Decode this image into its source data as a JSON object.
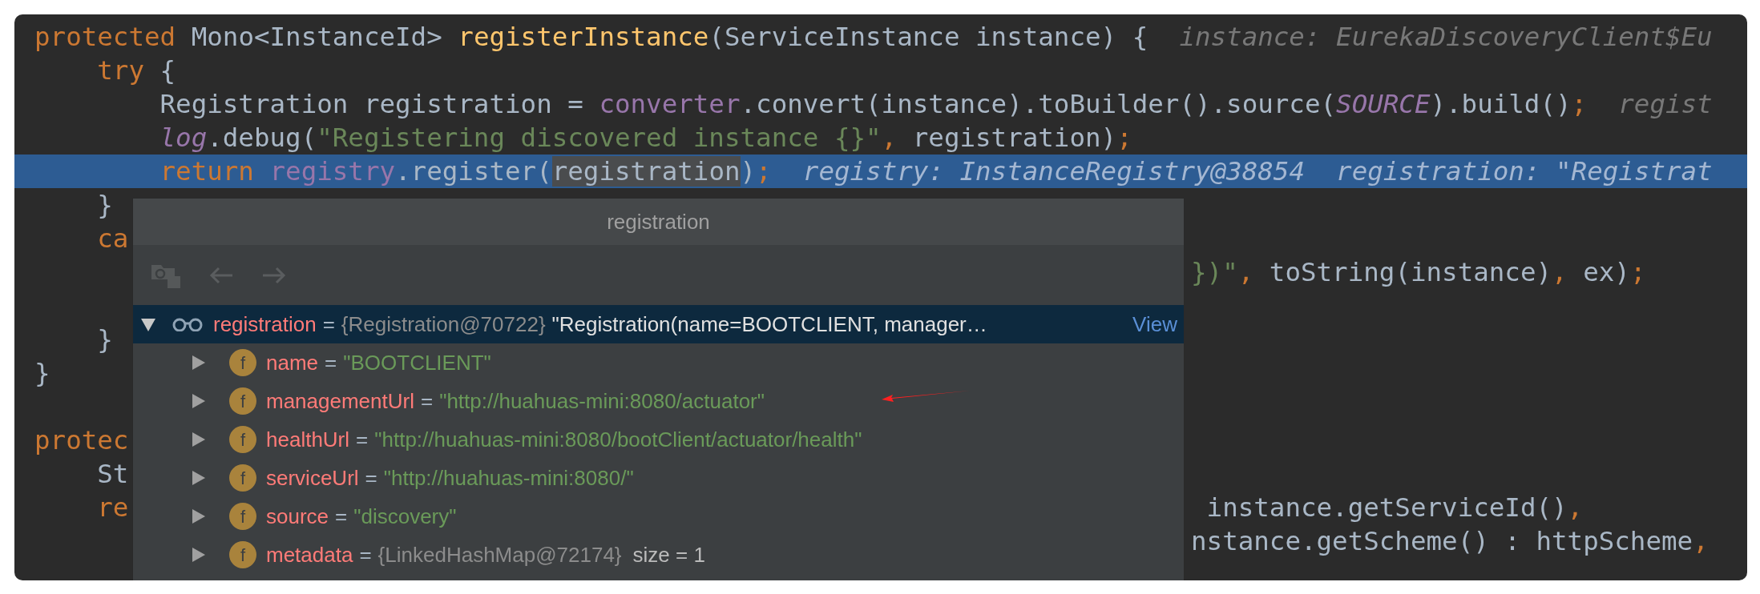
{
  "code_lines": [
    {
      "highlighted": false,
      "segments": [
        {
          "kind": "keyword",
          "text": "protected"
        },
        {
          "kind": "plain",
          "text": " Mono<InstanceId> "
        },
        {
          "kind": "method",
          "text": "registerInstance"
        },
        {
          "kind": "plain",
          "text": "(ServiceInstance instance) {"
        },
        {
          "kind": "hint",
          "text": "  instance: EurekaDiscoveryClient$Eu"
        }
      ]
    },
    {
      "highlighted": false,
      "segments": [
        {
          "kind": "keyword",
          "text": "    try"
        },
        {
          "kind": "plain",
          "text": " {"
        }
      ]
    },
    {
      "highlighted": false,
      "segments": [
        {
          "kind": "plain",
          "text": "        Registration registration = "
        },
        {
          "kind": "field",
          "text": "converter"
        },
        {
          "kind": "plain",
          "text": ".convert(instance).toBuilder().source("
        },
        {
          "kind": "static",
          "text": "SOURCE"
        },
        {
          "kind": "plain",
          "text": ").build()"
        },
        {
          "kind": "keyword",
          "text": ";"
        },
        {
          "kind": "hint",
          "text": "  regist"
        }
      ]
    },
    {
      "highlighted": false,
      "segments": [
        {
          "kind": "static",
          "text": "        log"
        },
        {
          "kind": "plain",
          "text": ".debug("
        },
        {
          "kind": "string",
          "text": "\"Registering discovered instance {}\""
        },
        {
          "kind": "keyword",
          "text": ","
        },
        {
          "kind": "plain",
          "text": " registration)"
        },
        {
          "kind": "keyword",
          "text": ";"
        }
      ]
    },
    {
      "highlighted": true,
      "segments": [
        {
          "kind": "keyword",
          "text": "        return "
        },
        {
          "kind": "field",
          "text": "registry"
        },
        {
          "kind": "plain",
          "text": ".register("
        },
        {
          "kind": "selection",
          "text": "registration"
        },
        {
          "kind": "plain",
          "text": ")"
        },
        {
          "kind": "keyword",
          "text": ";"
        },
        {
          "kind": "hint",
          "text": "  registry: InstanceRegistry@38854  registration: \"Registrat"
        }
      ]
    },
    {
      "highlighted": false,
      "segments": [
        {
          "kind": "plain",
          "text": "    }"
        }
      ]
    },
    {
      "highlighted": false,
      "segments": [
        {
          "kind": "keyword",
          "text": "    ca"
        }
      ]
    },
    {
      "highlighted": false,
      "right_segments": [
        {
          "kind": "string",
          "text": "})\""
        },
        {
          "kind": "keyword",
          "text": ","
        },
        {
          "kind": "plain",
          "text": " toString(instance)"
        },
        {
          "kind": "keyword",
          "text": ","
        },
        {
          "kind": "plain",
          "text": " ex)"
        },
        {
          "kind": "keyword",
          "text": ";"
        }
      ]
    },
    {
      "highlighted": false
    },
    {
      "highlighted": false,
      "segments": [
        {
          "kind": "plain",
          "text": "    }"
        }
      ]
    },
    {
      "highlighted": false,
      "segments": [
        {
          "kind": "plain",
          "text": "}"
        }
      ]
    },
    {
      "highlighted": false
    },
    {
      "highlighted": false,
      "segments": [
        {
          "kind": "keyword",
          "text": "protec"
        }
      ]
    },
    {
      "highlighted": false,
      "segments": [
        {
          "kind": "plain",
          "text": "    St"
        }
      ]
    },
    {
      "highlighted": false,
      "segments": [
        {
          "kind": "keyword",
          "text": "    re"
        }
      ],
      "right_segments": [
        {
          "kind": "plain",
          "text": " instance.getServiceId()"
        },
        {
          "kind": "keyword",
          "text": ","
        }
      ]
    },
    {
      "highlighted": false,
      "right_segments": [
        {
          "kind": "plain",
          "text": "nstance.getScheme() : httpScheme"
        },
        {
          "kind": "keyword",
          "text": ","
        }
      ]
    }
  ],
  "popup": {
    "title": "registration",
    "tree": [
      {
        "name": "registration",
        "separator": "=",
        "value": "{Registration@70722}",
        "summary": "\"Registration(name=BOOTCLIENT, manager…",
        "link": "View",
        "selected": true,
        "expanded": true,
        "children": [
          {
            "icon": "f",
            "name": "name",
            "separator": "=",
            "kind": "string",
            "value": "\"BOOTCLIENT\"",
            "expanded": false
          },
          {
            "icon": "f",
            "name": "managementUrl",
            "separator": "=",
            "kind": "string",
            "value": "\"http://huahuas-mini:8080/actuator\"",
            "expanded": false
          },
          {
            "icon": "f",
            "name": "healthUrl",
            "separator": "=",
            "kind": "string",
            "value": "\"http://huahuas-mini:8080/bootClient/actuator/health\"",
            "expanded": false
          },
          {
            "icon": "f",
            "name": "serviceUrl",
            "separator": "=",
            "kind": "string",
            "value": "\"http://huahuas-mini:8080/\"",
            "expanded": false
          },
          {
            "icon": "f",
            "name": "source",
            "separator": "=",
            "kind": "string",
            "value": "\"discovery\"",
            "expanded": false
          },
          {
            "icon": "f",
            "name": "metadata",
            "separator": "=",
            "kind": "object",
            "value": "{LinkedHashMap@72174}",
            "extra": "size = 1",
            "expanded": false
          }
        ]
      }
    ]
  }
}
